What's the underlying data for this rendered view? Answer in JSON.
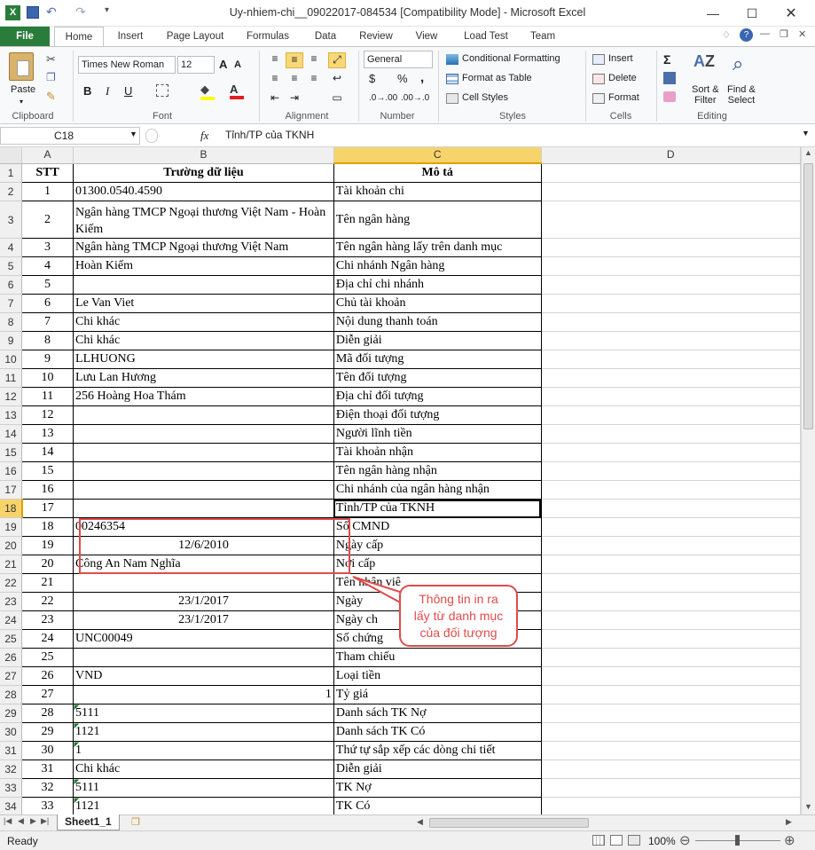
{
  "window": {
    "title": "Uy-nhiem-chi__09022017-084534  [Compatibility Mode]  -  Microsoft Excel",
    "controls": [
      "minimize",
      "maximize",
      "close"
    ]
  },
  "tabs": [
    "File",
    "Home",
    "Insert",
    "Page Layout",
    "Formulas",
    "Data",
    "Review",
    "View",
    "Load Test",
    "Team"
  ],
  "ribbon": {
    "clipboard": {
      "paste": "Paste",
      "label": "Clipboard"
    },
    "font": {
      "name": "Times New Roman",
      "size": "12",
      "label": "Font"
    },
    "alignment": {
      "label": "Alignment"
    },
    "number": {
      "format": "General",
      "label": "Number"
    },
    "styles": {
      "conditional": "Conditional Formatting",
      "table": "Format as Table",
      "cell": "Cell Styles",
      "label": "Styles"
    },
    "cells": {
      "insert": "Insert",
      "delete": "Delete",
      "format": "Format",
      "label": "Cells"
    },
    "editing": {
      "sort": "Sort &",
      "sort2": "Filter",
      "find": "Find &",
      "find2": "Select",
      "label": "Editing"
    }
  },
  "formula_bar": {
    "name_box": "C18",
    "fx": "fx",
    "content": "Tỉnh/TP của TKNH"
  },
  "columns": [
    "A",
    "B",
    "C",
    "D"
  ],
  "rows": [
    {
      "n": "1",
      "a": "STT",
      "b": "Trường dữ liệu",
      "c": "Mô tả"
    },
    {
      "n": "2",
      "a": "1",
      "b": "01300.0540.4590",
      "c": "Tài khoản chi"
    },
    {
      "n": "3",
      "a": "2",
      "b": "Ngân hàng TMCP Ngoại thương Việt Nam - Hoàn Kiếm",
      "c": "Tên ngân hàng"
    },
    {
      "n": "4",
      "a": "3",
      "b": "Ngân hàng TMCP Ngoại thương Việt Nam",
      "c": "Tên ngân hàng lấy trên danh mục"
    },
    {
      "n": "5",
      "a": "4",
      "b": "Hoàn Kiếm",
      "c": "Chi nhánh Ngân hàng"
    },
    {
      "n": "6",
      "a": "5",
      "b": "",
      "c": "Địa chỉ chi nhánh"
    },
    {
      "n": "7",
      "a": "6",
      "b": "Le Van Viet",
      "c": "Chủ  tài khoản"
    },
    {
      "n": "8",
      "a": "7",
      "b": "Chi khác",
      "c": "Nội dung thanh toán"
    },
    {
      "n": "9",
      "a": "8",
      "b": "Chi khác",
      "c": "Diễn giải"
    },
    {
      "n": "10",
      "a": "9",
      "b": "LLHUONG",
      "c": "Mã đối tượng"
    },
    {
      "n": "11",
      "a": "10",
      "b": "Lưu Lan Hương",
      "c": "Tên đối tượng"
    },
    {
      "n": "12",
      "a": "11",
      "b": "256 Hoàng Hoa Thám",
      "c": "Địa chỉ đối tượng"
    },
    {
      "n": "13",
      "a": "12",
      "b": "",
      "c": "Điện thoại đối tượng"
    },
    {
      "n": "14",
      "a": "13",
      "b": "",
      "c": "Người lĩnh tiền"
    },
    {
      "n": "15",
      "a": "14",
      "b": "",
      "c": "Tài khoản nhận"
    },
    {
      "n": "16",
      "a": "15",
      "b": "",
      "c": "Tên ngân hàng nhận"
    },
    {
      "n": "17",
      "a": "16",
      "b": "",
      "c": "Chi nhánh của ngân hàng nhận"
    },
    {
      "n": "18",
      "a": "17",
      "b": "",
      "c": "Tỉnh/TP của TKNH"
    },
    {
      "n": "19",
      "a": "18",
      "b": "00246354",
      "c": "Số CMND"
    },
    {
      "n": "20",
      "a": "19",
      "b": "12/6/2010",
      "c": "Ngày cấp"
    },
    {
      "n": "21",
      "a": "20",
      "b": "Công An Nam Nghĩa",
      "c": "Nơi cấp"
    },
    {
      "n": "22",
      "a": "21",
      "b": "",
      "c": "Tên nhân viê"
    },
    {
      "n": "23",
      "a": "22",
      "b": "23/1/2017",
      "c": "Ngày"
    },
    {
      "n": "24",
      "a": "23",
      "b": "23/1/2017",
      "c": "Ngày ch"
    },
    {
      "n": "25",
      "a": "24",
      "b": "UNC00049",
      "c": "Số chứng"
    },
    {
      "n": "26",
      "a": "25",
      "b": "",
      "c": "Tham chiếu"
    },
    {
      "n": "27",
      "a": "26",
      "b": "VND",
      "c": "Loại tiền"
    },
    {
      "n": "28",
      "a": "27",
      "b": "1",
      "c": "Tỷ giá"
    },
    {
      "n": "29",
      "a": "28",
      "b": "5111",
      "c": "Danh sách TK Nợ"
    },
    {
      "n": "30",
      "a": "29",
      "b": "1121",
      "c": "Danh sách TK Có"
    },
    {
      "n": "31",
      "a": "30",
      "b": "1",
      "c": "Thứ tự sắp xếp các dòng chi tiết"
    },
    {
      "n": "32",
      "a": "31",
      "b": "Chi khác",
      "c": "Diễn giải"
    },
    {
      "n": "33",
      "a": "32",
      "b": "5111",
      "c": "TK Nợ"
    },
    {
      "n": "34",
      "a": "33",
      "b": "1121",
      "c": "TK Có"
    }
  ],
  "callout": {
    "line1": "Thông tin in ra",
    "line2": "lấy từ danh mục",
    "line3": "của đối tượng"
  },
  "sheet_tab": "Sheet1_1",
  "status": {
    "ready": "Ready",
    "zoom": "100%"
  },
  "colors": {
    "excel_green": "#2a7c3b",
    "callout_red": "#e04b4b",
    "selected_header": "#f7d46b"
  }
}
